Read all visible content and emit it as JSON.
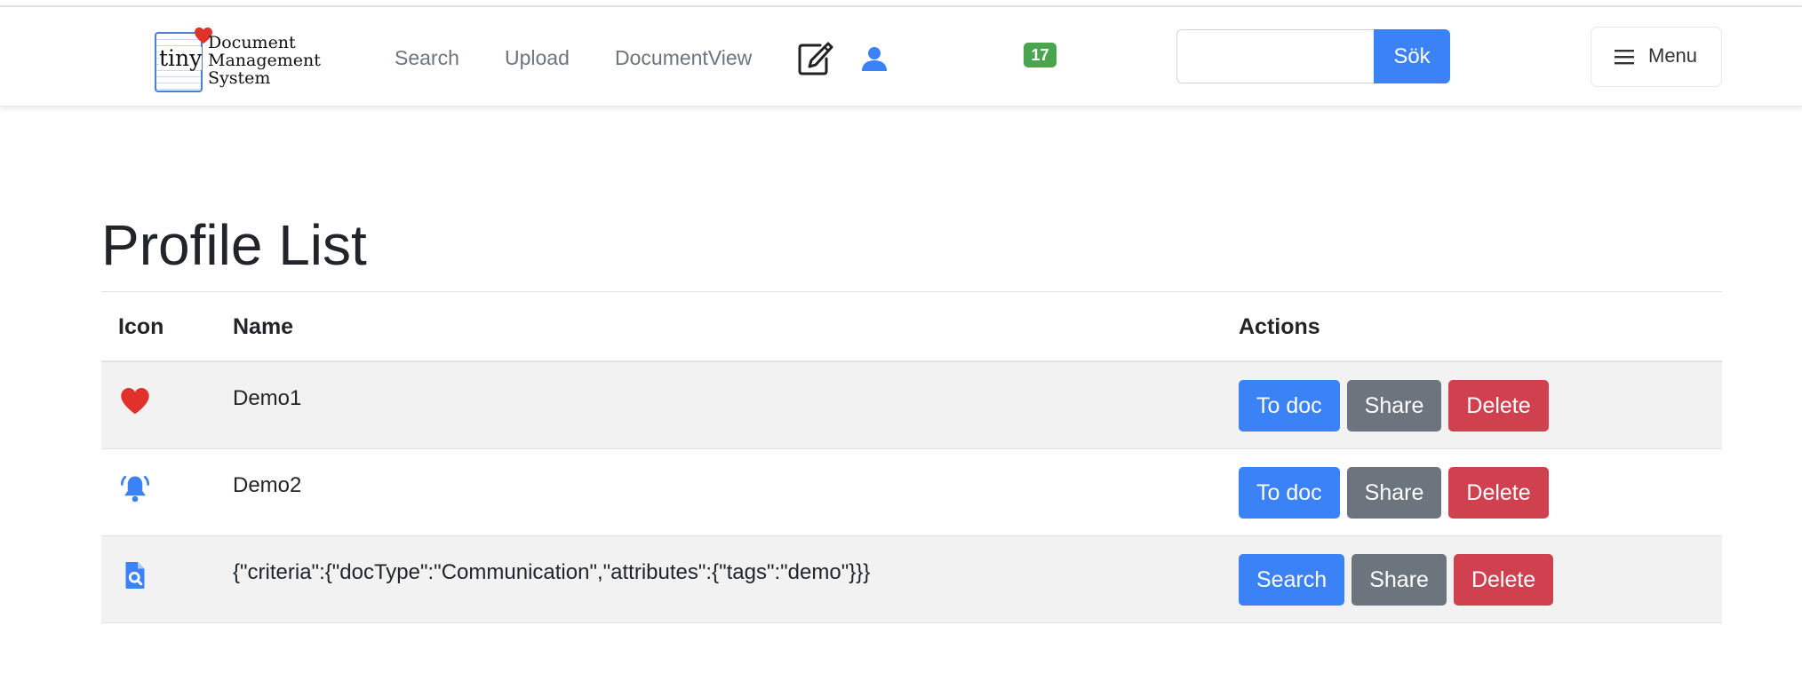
{
  "brand": {
    "logo_word": "tiny",
    "lines": [
      "Document",
      "Management",
      "System"
    ]
  },
  "nav": {
    "links": [
      "Search",
      "Upload",
      "DocumentView"
    ],
    "edit_icon": "edit-icon",
    "user_icon": "user-icon",
    "badge_count": "17"
  },
  "search": {
    "value": "",
    "placeholder": "",
    "button_label": "Sök"
  },
  "menu": {
    "label": "Menu",
    "icon": "hamburger-icon"
  },
  "page": {
    "title": "Profile List"
  },
  "table": {
    "headers": {
      "icon": "Icon",
      "name": "Name",
      "actions": "Actions"
    },
    "rows": [
      {
        "icon": "heart-icon",
        "name": "Demo1",
        "primary_action": "To doc",
        "share": "Share",
        "delete": "Delete"
      },
      {
        "icon": "bell-icon",
        "name": "Demo2",
        "primary_action": "To doc",
        "share": "Share",
        "delete": "Delete"
      },
      {
        "icon": "search-document-icon",
        "name": "{\"criteria\":{\"docType\":\"Communication\",\"attributes\":{\"tags\":\"demo\"}}}",
        "primary_action": "Search",
        "share": "Share",
        "delete": "Delete"
      }
    ]
  },
  "colors": {
    "primary": "#3b82f6",
    "secondary": "#6c757d",
    "danger": "#d0414f",
    "badge": "#4aa54f",
    "heart": "#e0312b"
  }
}
